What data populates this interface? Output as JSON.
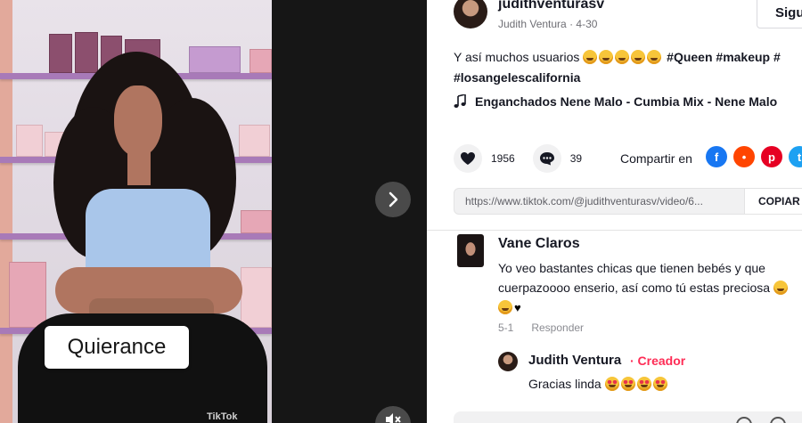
{
  "video": {
    "caption_overlay": "Quierance",
    "watermark": "TikTok",
    "next_icon": "chevron-right-icon",
    "mute_icon": "speaker-muted-icon"
  },
  "author": {
    "username": "judithventurasv",
    "display_name": "Judith Ventura",
    "date": "4-30",
    "follow_label": "Sigu"
  },
  "description": {
    "text": "Y así muchos usuarios",
    "hashtags": [
      "#Queen",
      "#makeup",
      "#losangelescalifornia"
    ]
  },
  "music": {
    "icon": "music-note-icon",
    "title": "Enganchados Nene Malo - Cumbia Mix - Nene Malo"
  },
  "stats": {
    "likes": "1956",
    "comments": "39",
    "share_label": "Compartir en"
  },
  "share_targets": [
    {
      "name": "facebook-icon",
      "color": "#1877f2",
      "glyph": "f"
    },
    {
      "name": "reddit-icon",
      "color": "#ff4500",
      "glyph": "•"
    },
    {
      "name": "pinterest-icon",
      "color": "#e60023",
      "glyph": "p"
    },
    {
      "name": "twitter-icon",
      "color": "#1da1f2",
      "glyph": "t"
    }
  ],
  "link": {
    "url": "https://www.tiktok.com/@judithventurasv/video/6...",
    "copy_label": "COPIAR"
  },
  "comment": {
    "author": "Vane Claros",
    "text": "Yo veo bastantes chicas que tienen bebés y que cuerpazoooo enserio, así como tú estas preciosa",
    "date": "5-1",
    "reply_label": "Responder"
  },
  "reply": {
    "author": "Judith Ventura",
    "creator_label": "· Creador",
    "text": "Gracias linda"
  }
}
